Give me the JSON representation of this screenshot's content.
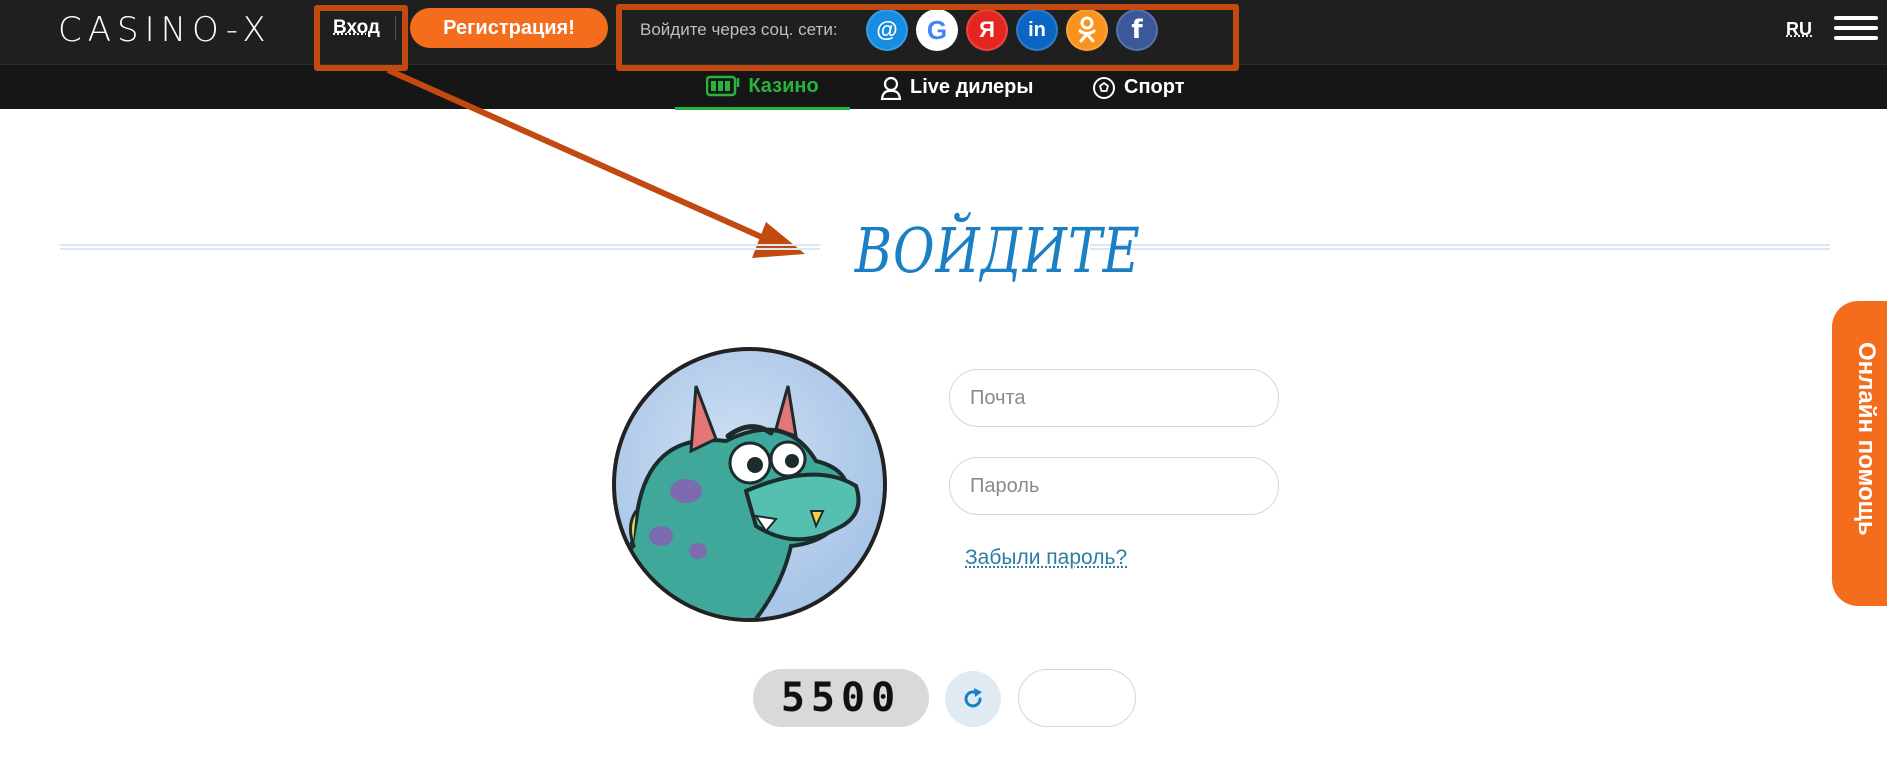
{
  "header": {
    "logo": "CASINO-X",
    "login_label": "Вход",
    "register_label": "Регистрация!",
    "social_text": "Войдите через соц. сети:",
    "social": [
      {
        "name": "mail",
        "glyph": "@",
        "color": "#168de2"
      },
      {
        "name": "google",
        "glyph": "G",
        "color": "#ffffff"
      },
      {
        "name": "yandex",
        "glyph": "Я",
        "color": "#e52620"
      },
      {
        "name": "linkedin",
        "glyph": "in",
        "color": "#0a66c2"
      },
      {
        "name": "odnoklassniki",
        "glyph": "ok",
        "color": "#f7931e"
      },
      {
        "name": "facebook",
        "glyph": "f",
        "color": "#3b5998"
      }
    ],
    "language": "RU"
  },
  "nav": {
    "items": [
      {
        "label": "Казино",
        "icon": "slot-machine-icon",
        "active": true
      },
      {
        "label": "Live дилеры",
        "icon": "dealer-icon",
        "active": false
      },
      {
        "label": "Спорт",
        "icon": "soccer-ball-icon",
        "active": false
      }
    ]
  },
  "main": {
    "title": "ВОЙДИТЕ",
    "email_placeholder": "Почта",
    "password_placeholder": "Пароль",
    "forgot_label": "Забыли пароль?",
    "captcha_text": "5500"
  },
  "help": {
    "label": "Онлайн помощь"
  },
  "colors": {
    "accent_orange": "#f36d1d",
    "active_green": "#29b33e",
    "title_blue": "#1b7fc4",
    "annotation": "#c2490f"
  }
}
